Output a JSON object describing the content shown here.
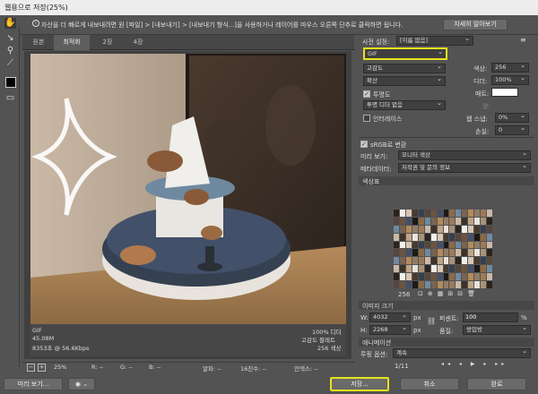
{
  "title": "웹용으로 저장(25%)",
  "info": {
    "text": "자산을 더 빠르게 내보내려면 원 [파일] > [내보내기] > [내보내기 형식...]을 사용하거나 레이어를 마우스 오른쪽 단추로 클릭하면 됩니다.",
    "learn_more": "자세히 알아보기"
  },
  "tabs": [
    "원본",
    "최적화",
    "2장",
    "4장"
  ],
  "caption": {
    "format": "GIF",
    "size": "45.08M",
    "time": "8353초 @ 56.6Kbps",
    "quality": "100% 디더",
    "palette": "고감도 팔레트",
    "colors": "256 색상"
  },
  "status": {
    "zoom": "25%",
    "r": "R: --",
    "g": "G: --",
    "b": "B: --",
    "alpha": "알파: --",
    "hex": "16진수: --",
    "index": "인덱스: --"
  },
  "bottom": {
    "preview": "미리 보기...",
    "save": "저장...",
    "cancel": "취소",
    "done": "완료"
  },
  "settings": {
    "preset_label": "사전 설정:",
    "preset": "[이름 없음]",
    "format": "GIF",
    "reduction": "고감도",
    "colors_label": "색상:",
    "colors": "256",
    "dither_algo": "확산",
    "dither_label": "디더:",
    "dither": "100%",
    "transparency": "투명도",
    "matte_label": "매트:",
    "trans_dither": "투명 디더 없음",
    "amount_label": "양:",
    "interlaced": "인터레이스",
    "websnap_label": "웹 스냅:",
    "websnap": "0%",
    "lossy_label": "손실:",
    "lossy": "0",
    "srgb": "sRGB로 변환",
    "preview_label": "미리 보기:",
    "preview": "모니터 색상",
    "metadata_label": "메타데이터:",
    "metadata": "저작권 및 문의 정보"
  },
  "colortable": {
    "title": "색상표",
    "count": "256"
  },
  "imagesize": {
    "title": "이미지 크기",
    "w_label": "W:",
    "w": "4032",
    "h_label": "H:",
    "h": "2268",
    "unit": "px",
    "percent_label": "퍼센트:",
    "percent": "100",
    "pct": "%",
    "quality_label": "품질:",
    "quality": "쌍입방"
  },
  "animation": {
    "title": "애니메이션",
    "loop_label": "루핑 옵션:",
    "loop": "계속",
    "frame": "1/11"
  },
  "colors": {
    "accent": "#e7e21d",
    "bg": "#535353"
  }
}
